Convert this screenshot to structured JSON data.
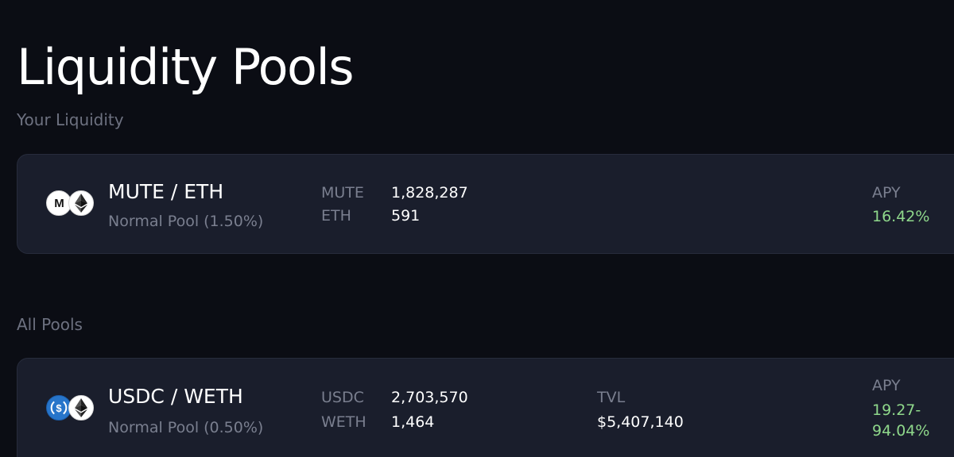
{
  "page": {
    "title": "Liquidity Pools"
  },
  "your_liquidity": {
    "heading": "Your Liquidity",
    "pools": [
      {
        "pair": "MUTE / ETH",
        "pool_type": "Normal Pool (1.50%)",
        "token_icons": [
          "mute-icon",
          "eth-icon"
        ],
        "reserves": [
          {
            "symbol": "MUTE",
            "amount": "1,828,287"
          },
          {
            "symbol": "ETH",
            "amount": "591"
          }
        ],
        "apy_label": "APY",
        "apy": "16.42%"
      }
    ]
  },
  "all_pools": {
    "heading": "All Pools",
    "pools": [
      {
        "pair": "USDC / WETH",
        "pool_type": "Normal Pool (0.50%)",
        "token_icons": [
          "usdc-icon",
          "weth-icon"
        ],
        "reserves": [
          {
            "symbol": "USDC",
            "amount": "2,703,570"
          },
          {
            "symbol": "WETH",
            "amount": "1,464"
          }
        ],
        "tvl_label": "TVL",
        "tvl": "$5,407,140",
        "apy_label": "APY",
        "apy_line1": "19.27-",
        "apy_line2": "94.04%"
      }
    ]
  },
  "colors": {
    "background": "#0b0d14",
    "card": "#1a1e2c",
    "muted_text": "#7a7f8f",
    "apy_green": "#8fd88b",
    "usdc_blue": "#2775ca"
  }
}
